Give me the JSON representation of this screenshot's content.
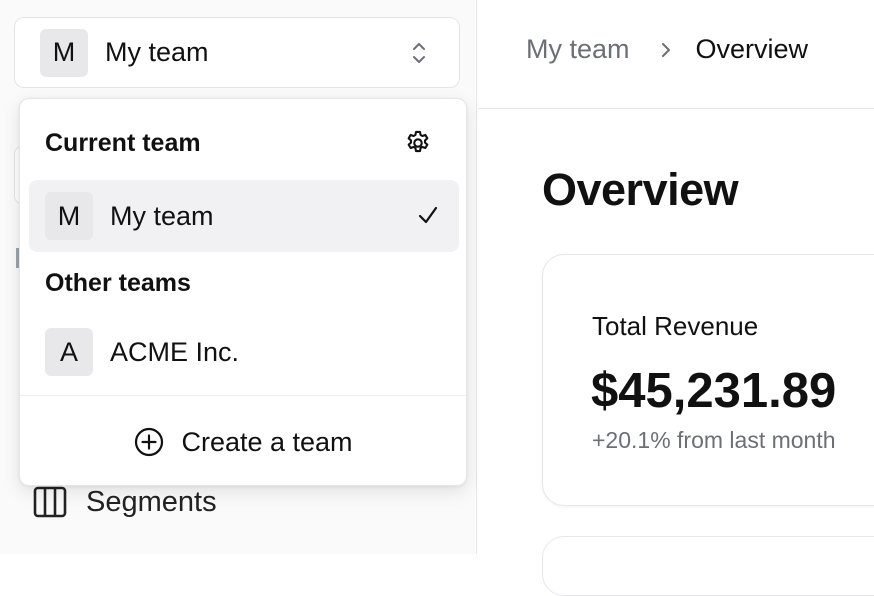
{
  "team_switcher": {
    "avatar_letter": "M",
    "label": "My team"
  },
  "dropdown": {
    "current_section_title": "Current team",
    "current_team": {
      "avatar_letter": "M",
      "label": "My team"
    },
    "other_section_title": "Other teams",
    "other_teams": [
      {
        "avatar_letter": "A",
        "label": "ACME Inc."
      }
    ],
    "create_label": "Create a team"
  },
  "sidebar": {
    "segments_label": "Segments"
  },
  "breadcrumb": {
    "parent": "My team",
    "current": "Overview"
  },
  "main": {
    "title": "Overview",
    "card": {
      "title": "Total Revenue",
      "value": "$45,231.89",
      "delta": "+20.1% from last month"
    }
  },
  "icons": {
    "switcher_chevron": "chevrons-up-down-icon",
    "settings": "gear-icon",
    "check": "check-icon",
    "create": "plus-circle-icon",
    "segments": "columns-icon",
    "breadcrumb_sep": "chevron-right-icon"
  },
  "colors": {
    "selected_row_bg": "#f1f1f3",
    "muted_text": "#6b6f76",
    "border": "#e5e7eb"
  }
}
